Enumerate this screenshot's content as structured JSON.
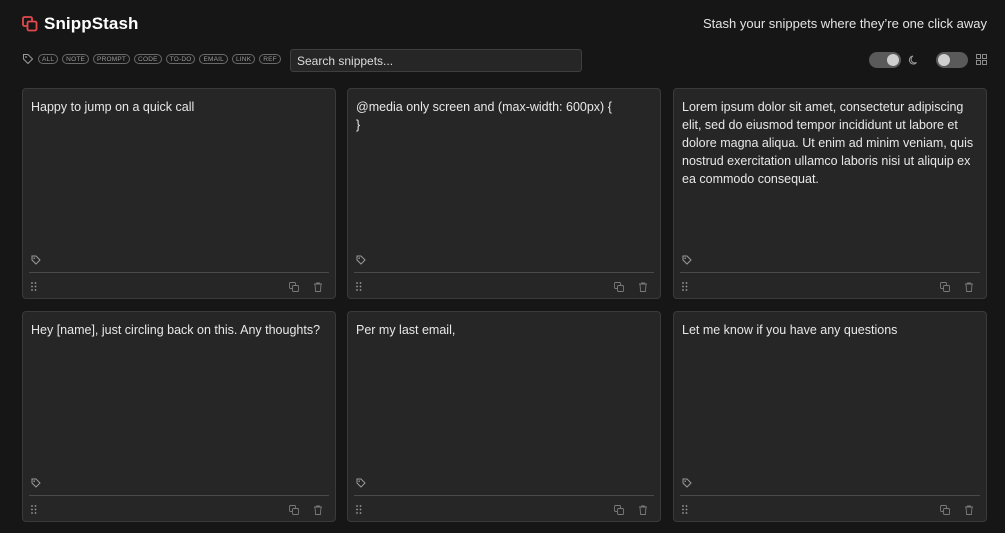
{
  "app": {
    "title": "SnippStash",
    "tagline": "Stash your snippets where they’re one click away",
    "accent": "#e5484d"
  },
  "toolbar": {
    "tags": [
      "ALL",
      "NOTE",
      "PROMPT",
      "CODE",
      "TO-DO",
      "EMAIL",
      "LINK",
      "REF"
    ],
    "search_placeholder": "Search snippets...",
    "theme_icon": "moon-icon",
    "layout_icon": "grid-icon"
  },
  "snippets": [
    {
      "text": "Happy to jump on a quick call"
    },
    {
      "text": "@media only screen and (max-width: 600px) {\n}"
    },
    {
      "text": "Lorem ipsum dolor sit amet, consectetur adipiscing elit, sed do eiusmod tempor incididunt ut labore et dolore magna aliqua. Ut enim ad minim veniam, quis nostrud exercitation ullamco laboris nisi ut aliquip ex ea commodo consequat."
    },
    {
      "text": "Hey [name], just circling back on this. Any thoughts?"
    },
    {
      "text": "Per my last email,"
    },
    {
      "text": "Let me know if you have any questions"
    }
  ]
}
